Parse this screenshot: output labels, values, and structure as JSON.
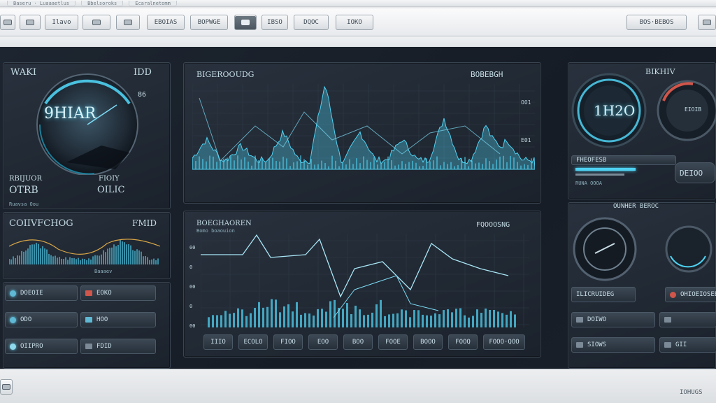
{
  "window": {
    "tabs": [
      "Baseru · Luaaaetlus",
      "Bbelsoroks",
      "Ecaralnetomm"
    ]
  },
  "toolbar": {
    "buttons": [
      "",
      "",
      "Ilavo",
      "",
      "",
      "EBOIAS",
      "BOPWGE",
      "",
      "IBSO",
      "DQOC",
      "IOKO"
    ],
    "right_label": "BOS·BEBOS",
    "colors": {
      "accent": "#4fd2f2",
      "accent_dark": "#1e7f9c"
    }
  },
  "left": {
    "gauge": {
      "title": "WAKI",
      "top_right": "IDD",
      "side": "86",
      "center_value": "9HIAR",
      "left_caption": "RBIJUOR",
      "left_value": "OTRB",
      "right_caption": "FIOIY",
      "right_value": "OILIC",
      "footnote": "Ruavsa Oou"
    },
    "wave": {
      "title": "COIIVFCHOG",
      "right": "FMID",
      "sub": "Baaaev"
    },
    "list": [
      {
        "a": "DOEOIE",
        "b": "EOKO"
      },
      {
        "a": "ODO",
        "b": "HOO"
      },
      {
        "a": "OIIPRO",
        "b": "FDID"
      }
    ]
  },
  "center": {
    "top_chart": {
      "title": "BIGEROOUDG",
      "legend": "BOBEBGH",
      "tick_1": "O01",
      "tick_2": "E01"
    },
    "bottom_chart": {
      "title": "BOEGHAOREN",
      "subtitle": "Bomo boaouion",
      "legend": "FQOOOSNG",
      "y_ticks": [
        "00",
        "0",
        "00",
        "0",
        "00"
      ],
      "bottom_buttons": [
        "IIIO",
        "ECOLO",
        "FIOO",
        "EOO",
        "BOO",
        "FOOE",
        "BOOO",
        "FOOQ",
        "FOOO·QOO"
      ]
    }
  },
  "right": {
    "gauge": {
      "title": "BIKHIV",
      "center_value": "1H2O",
      "side_label": "EIOIB",
      "meter_label": "DEIOO",
      "bar_label": "FHEOFESB",
      "row_label": "RUNA OOOA",
      "section": "OUNHER BEROC"
    },
    "controls": {
      "buttons": [
        "ILICRUIDEG",
        "OHIOEIOSEE"
      ],
      "rows": [
        {
          "a": "DOIWO",
          "b": ""
        },
        {
          "a": "SIOWS",
          "b": "GII"
        }
      ]
    }
  },
  "status": {
    "left_icon_label": "",
    "right_text": "IOHUGS"
  }
}
